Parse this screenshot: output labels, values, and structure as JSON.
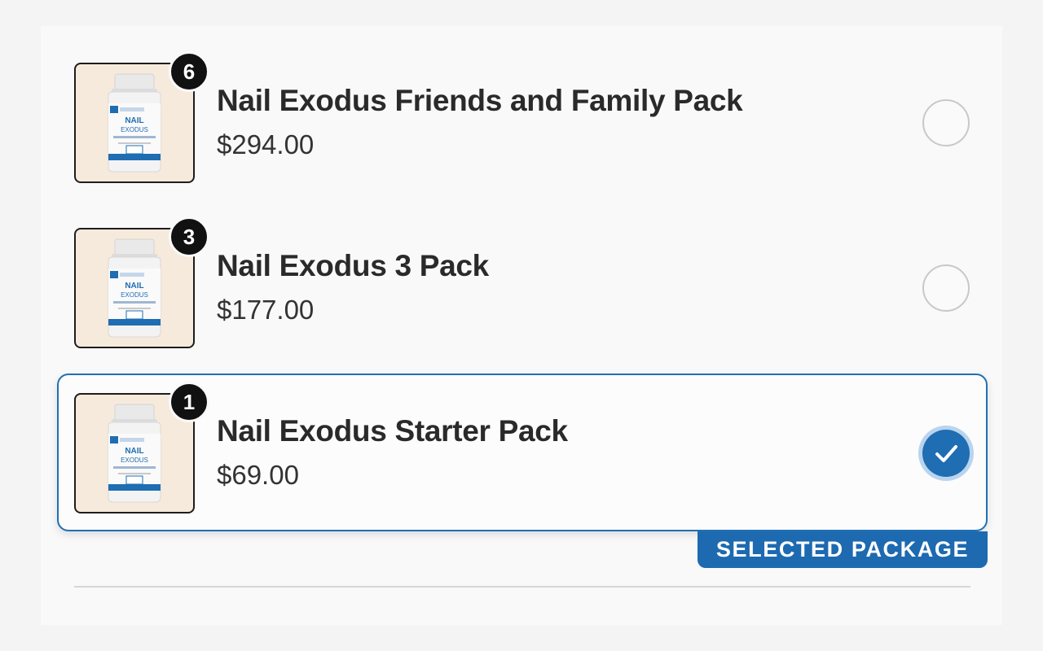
{
  "packages": [
    {
      "quantity": "6",
      "name": "Nail Exodus Friends and Family Pack",
      "price": "$294.00",
      "selected": false
    },
    {
      "quantity": "3",
      "name": "Nail Exodus 3 Pack",
      "price": "$177.00",
      "selected": false
    },
    {
      "quantity": "1",
      "name": "Nail Exodus Starter Pack",
      "price": "$69.00",
      "selected": true
    }
  ],
  "selected_label": "SELECTED PACKAGE",
  "product_image": {
    "brand_text": "vitality now",
    "label_line1": "NAIL",
    "label_line2": "EXODUS"
  },
  "colors": {
    "accent": "#1f6db2",
    "thumb_bg": "#f6eadc",
    "badge_bg": "#111111"
  },
  "icons": {
    "radio_unchecked": "radio-empty-icon",
    "radio_checked": "check-icon"
  }
}
